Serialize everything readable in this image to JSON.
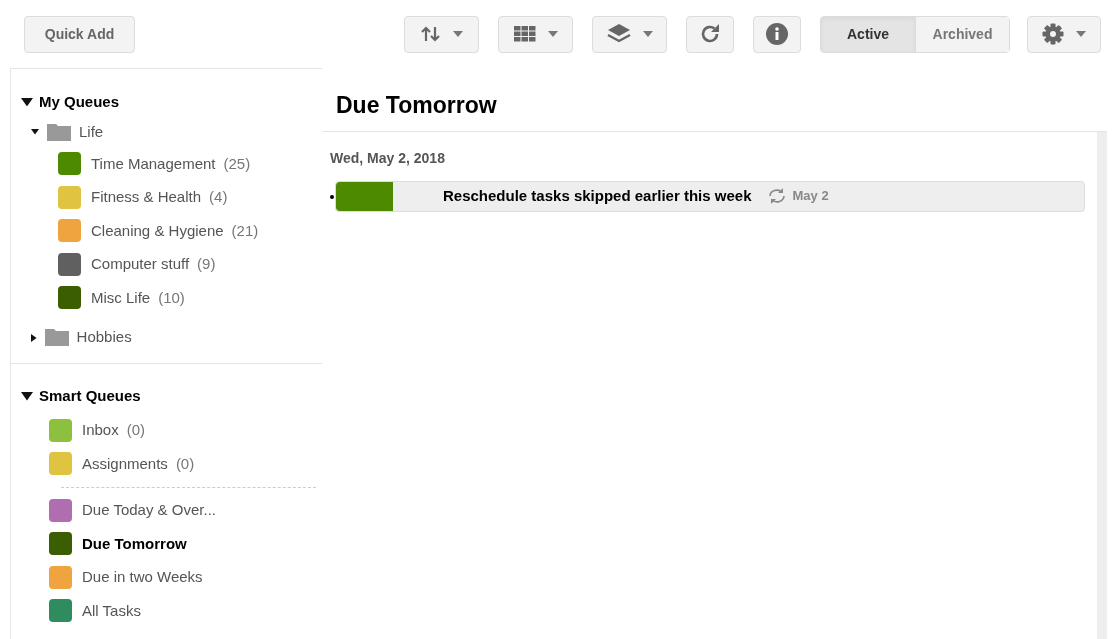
{
  "toolbar": {
    "quick_add": "Quick Add",
    "tools": [
      {
        "kind": "sort"
      },
      {
        "kind": "grid"
      },
      {
        "kind": "layers"
      },
      {
        "kind": "refresh"
      },
      {
        "kind": "info"
      }
    ],
    "filter": [
      {
        "label": "Active",
        "selected": true
      },
      {
        "label": "Archived",
        "selected": false
      }
    ],
    "settings": {
      "kind": "gear"
    }
  },
  "sidebar": {
    "sections": [
      {
        "title": "My Queues",
        "expanded": true,
        "folders": [
          {
            "name": "Life",
            "expanded": true,
            "queues": [
              {
                "name": "Time Management",
                "count": "(25)",
                "color": "#4e8a00",
                "selected": false
              },
              {
                "name": "Fitness & Health",
                "count": "(4)",
                "color": "#e0c340",
                "selected": false
              },
              {
                "name": "Cleaning & Hygiene",
                "count": "(21)",
                "color": "#f0a440",
                "selected": false
              },
              {
                "name": "Computer stuff",
                "count": "(9)",
                "color": "#606060",
                "selected": false
              },
              {
                "name": "Misc Life",
                "count": "(10)",
                "color": "#3a5e00",
                "selected": false
              }
            ]
          },
          {
            "name": "Hobbies",
            "expanded": false
          }
        ]
      },
      {
        "title": "Smart Queues",
        "expanded": true,
        "groups": [
          [
            {
              "name": "Inbox",
              "count": "(0)",
              "color": "#8dc03f",
              "selected": false
            },
            {
              "name": "Assignments",
              "count": "(0)",
              "color": "#e0c340",
              "selected": false
            }
          ],
          [
            {
              "name": "Due Today & Over...",
              "color": "#b06eb0",
              "selected": false
            },
            {
              "name": "Due Tomorrow",
              "color": "#3a5e00",
              "selected": true
            },
            {
              "name": "Due in two Weeks",
              "color": "#f0a440",
              "selected": false
            },
            {
              "name": "All Tasks",
              "color": "#2e8c5e",
              "selected": false
            }
          ]
        ]
      }
    ]
  },
  "main": {
    "title": "Due Tomorrow",
    "days": [
      {
        "date": "Wed, May 2, 2018",
        "tasks": [
          {
            "title": "Reschedule tasks skipped earlier this week",
            "color": "#4e8a00",
            "repeat": "May 2"
          }
        ]
      }
    ]
  }
}
